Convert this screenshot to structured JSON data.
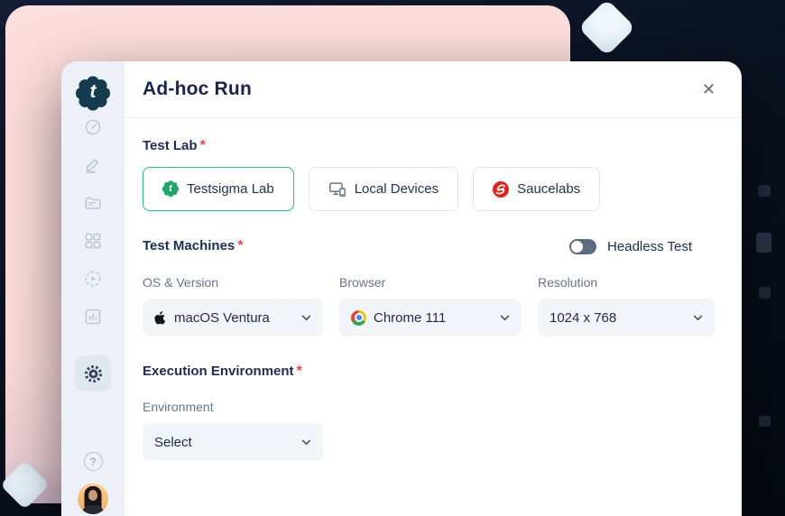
{
  "dialog": {
    "title": "Ad-hoc Run",
    "close_glyph": "✕"
  },
  "sidebar": {
    "logo_letter": "t",
    "help_glyph": "?",
    "items": [
      {
        "icon": "gauge-icon",
        "name": "dashboard",
        "active": false
      },
      {
        "icon": "pencil-icon",
        "name": "create-tests",
        "active": false
      },
      {
        "icon": "folder-icon",
        "name": "test-development",
        "active": false
      },
      {
        "icon": "grid-icon",
        "name": "elements",
        "active": false
      },
      {
        "icon": "play-circle-icon",
        "name": "test-runs",
        "active": false
      },
      {
        "icon": "bar-chart-icon",
        "name": "reports",
        "active": false
      },
      {
        "icon": "gear-icon",
        "name": "settings",
        "active": true
      }
    ]
  },
  "form": {
    "test_lab": {
      "label": "Test Lab",
      "required_marker": "*",
      "options": [
        {
          "label": "Testsigma Lab",
          "icon": "testsigma-gear-icon",
          "icon_letter": "t",
          "selected": true
        },
        {
          "label": "Local Devices",
          "icon": "devices-icon",
          "selected": false
        },
        {
          "label": "Saucelabs",
          "icon": "saucelabs-icon",
          "selected": false
        }
      ]
    },
    "test_machines": {
      "label": "Test Machines",
      "required_marker": "*",
      "headless": {
        "label": "Headless Test",
        "enabled": false
      }
    },
    "machine_selects": [
      {
        "label": "OS & Version",
        "value": "macOS Ventura",
        "icon": "apple-icon"
      },
      {
        "label": "Browser",
        "value": "Chrome 111",
        "icon": "chrome-icon"
      },
      {
        "label": "Resolution",
        "value": "1024 x 768",
        "icon": null
      }
    ],
    "execution_environment": {
      "label": "Execution Environment",
      "required_marker": "*",
      "environment": {
        "label": "Environment",
        "value": "Select"
      }
    }
  },
  "colors": {
    "accent_green": "#2eb886",
    "testsigma_green": "#1fa76a",
    "logo_teal": "#143b4f",
    "saucelabs_red": "#e2231a",
    "pink_backdrop": "#fcdcdc",
    "dark_backdrop": "#0a1120",
    "required_red": "#e5484d",
    "field_bg": "#f2f5f9"
  }
}
